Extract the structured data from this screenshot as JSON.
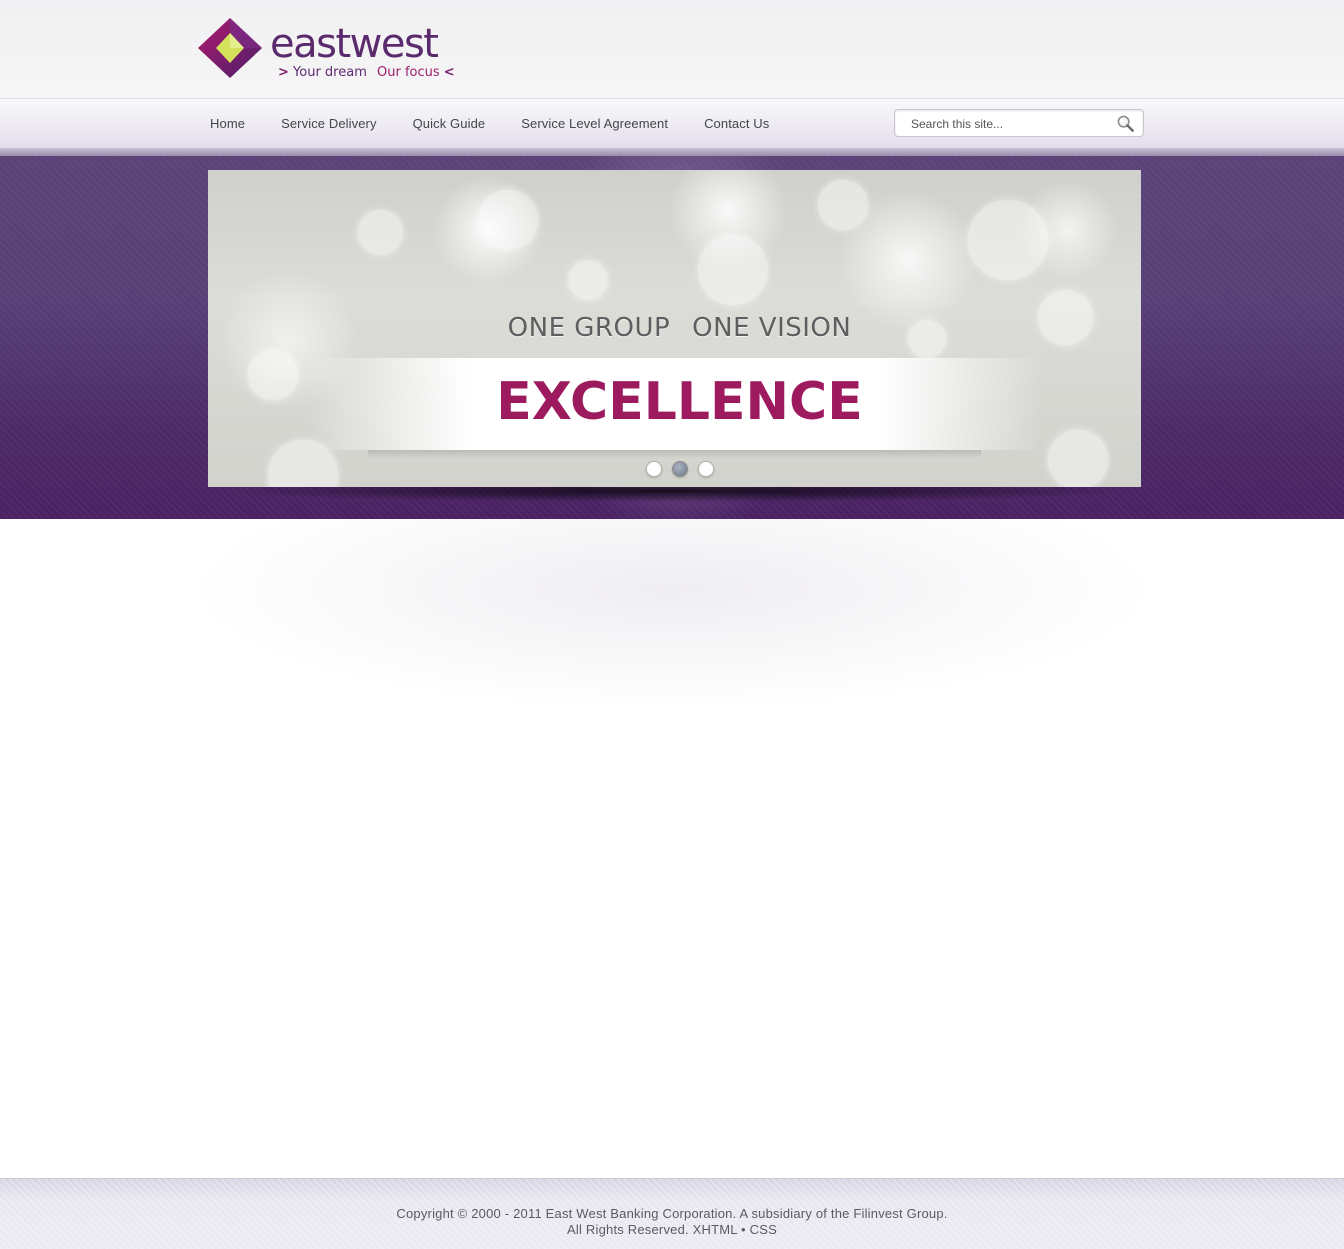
{
  "header": {
    "brand": "eastwest",
    "tagline_part1": "Your dream",
    "tagline_part2": "Our focus"
  },
  "nav": {
    "items": [
      {
        "label": "Home"
      },
      {
        "label": "Service Delivery"
      },
      {
        "label": "Quick Guide"
      },
      {
        "label": "Service Level Agreement"
      },
      {
        "label": "Contact Us"
      }
    ]
  },
  "search": {
    "placeholder": "Search this site...",
    "icon": "magnifier-icon"
  },
  "slider": {
    "slogan_left": "ONE GROUP",
    "slogan_right": "ONE VISION",
    "headline": "EXCELLENCE",
    "active_slide": 2,
    "slide_count": 3,
    "colors": {
      "headline": "#9e1a5f",
      "band": "#4c2a66"
    }
  },
  "footer": {
    "copyright": "Copyright © 2000 - 2011 East West Banking Corporation. A subsidiary of the Filinvest Group.",
    "rights": "All Rights Reserved.",
    "link_xhtml": "XHTML",
    "separator": "•",
    "link_css": "CSS"
  }
}
